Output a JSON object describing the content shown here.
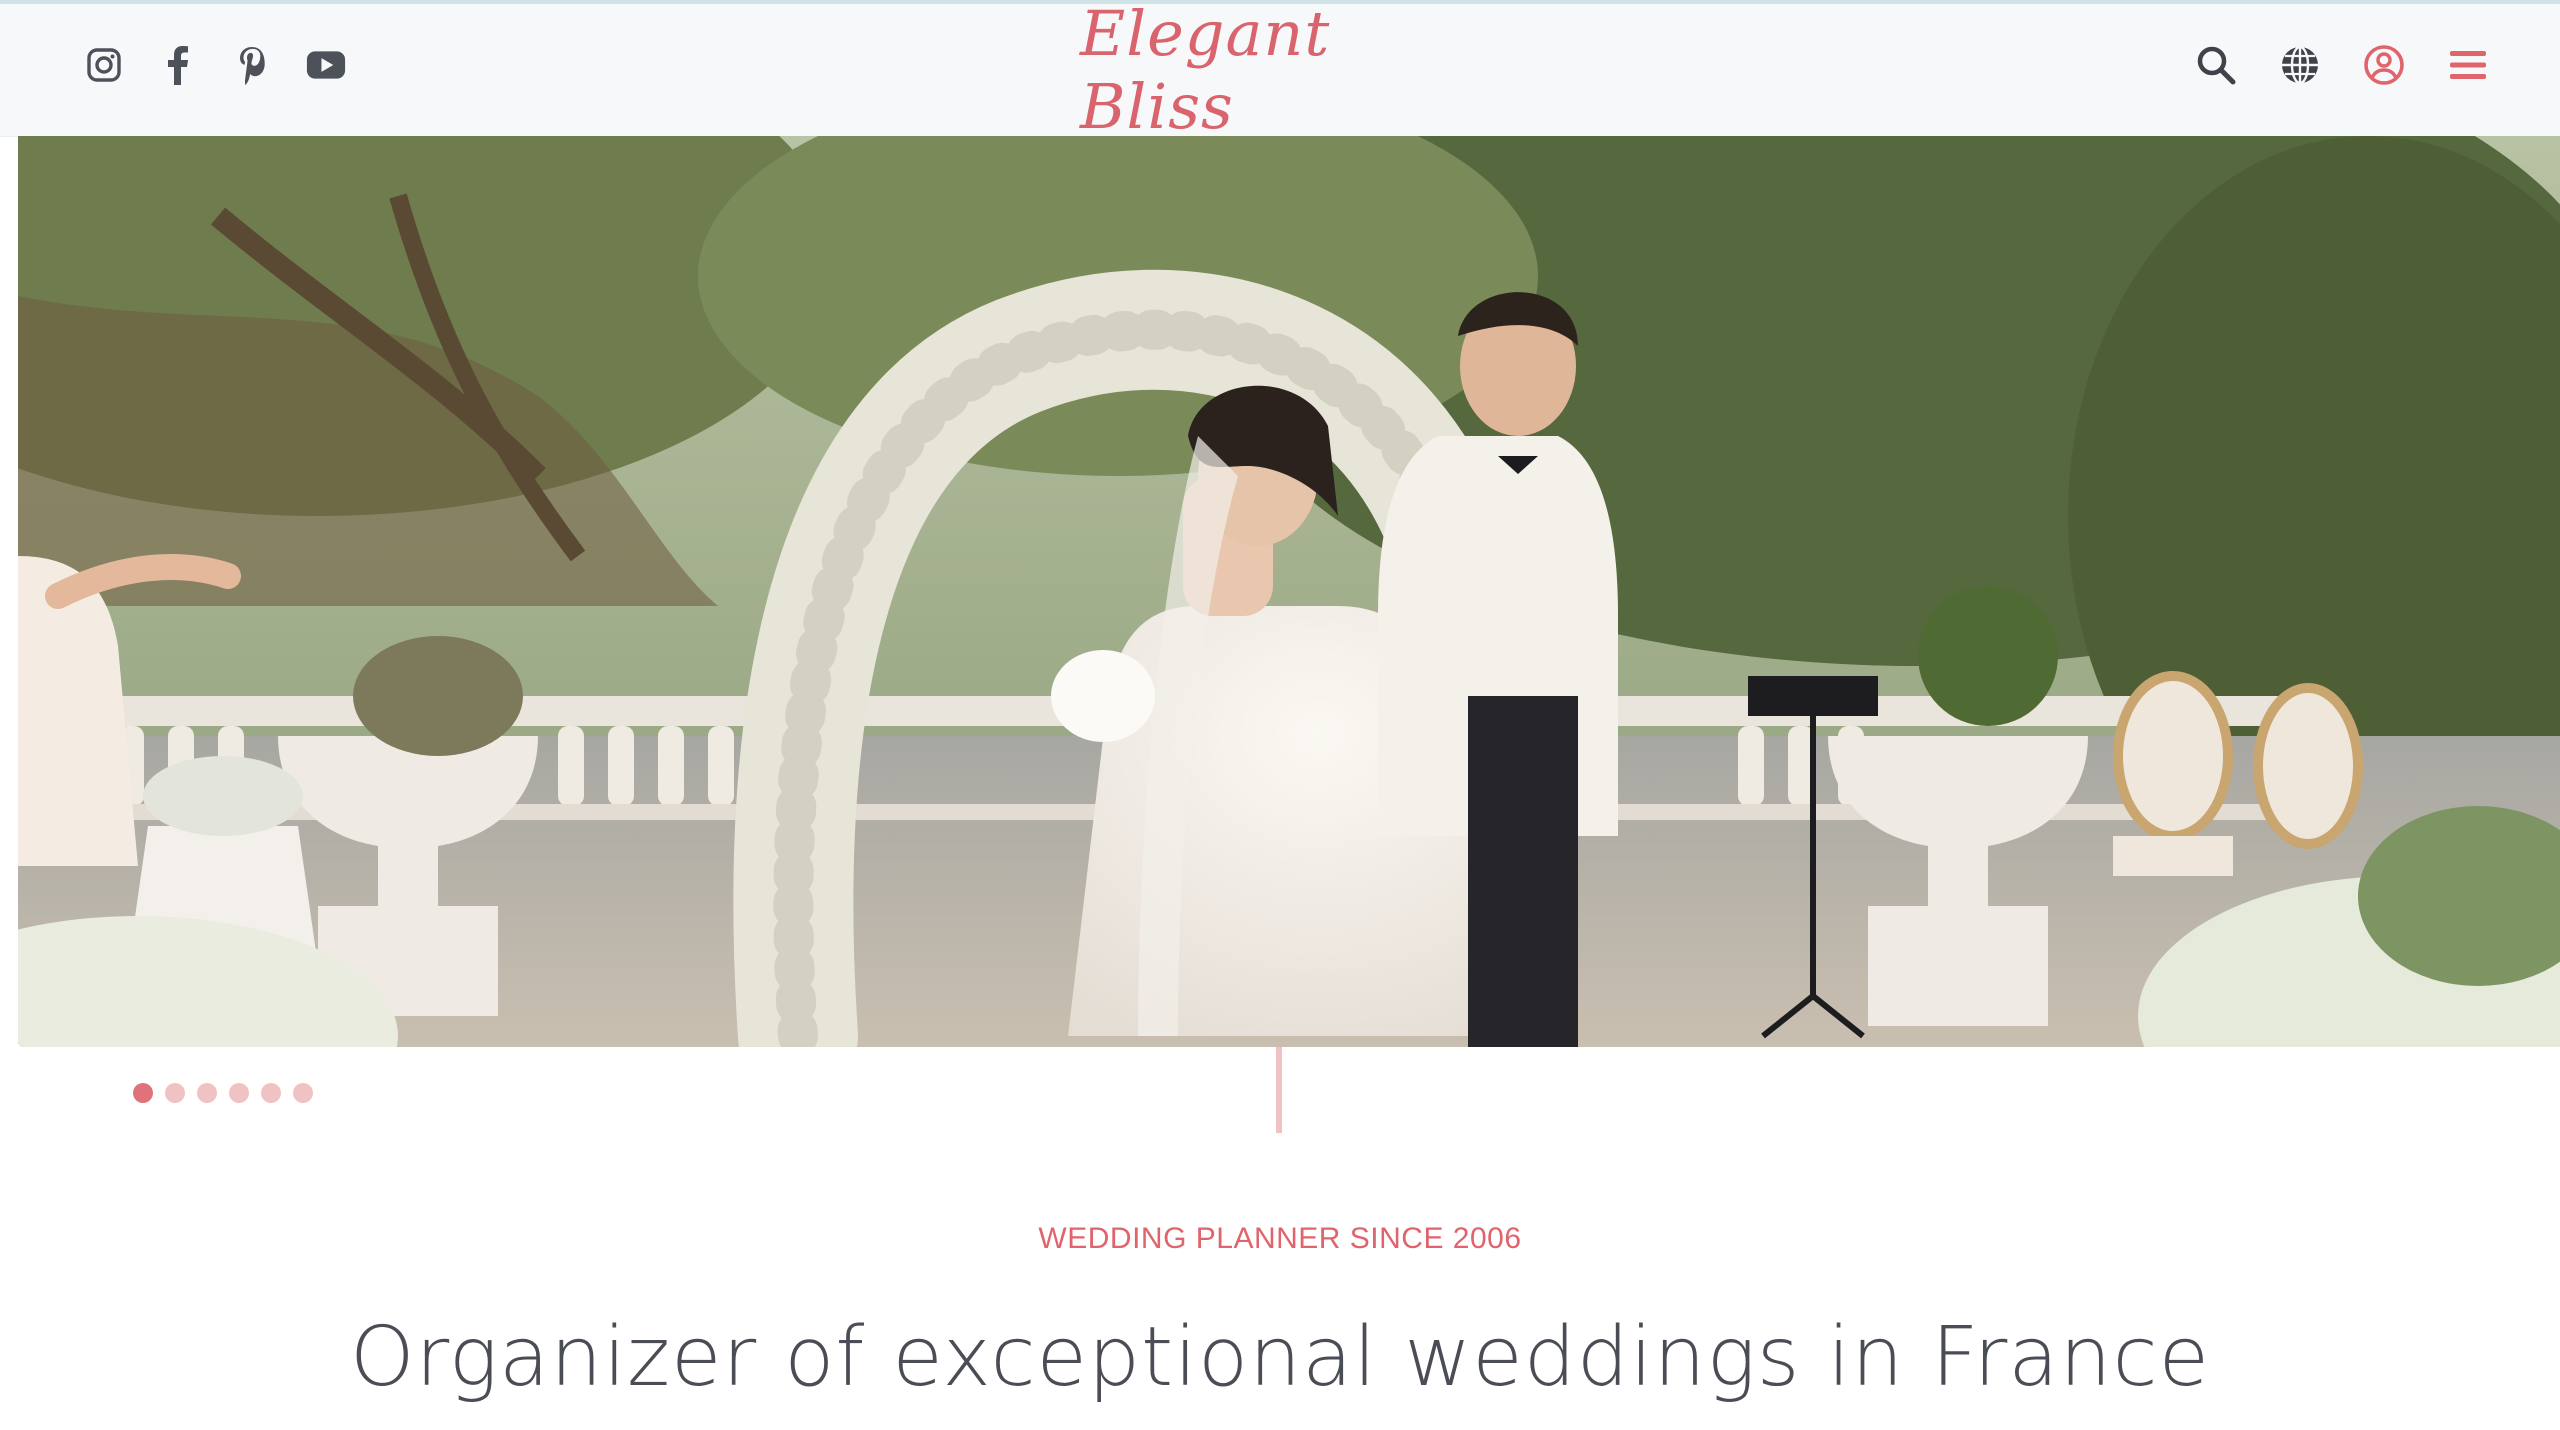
{
  "header": {
    "logo_text": "Elegant Bliss",
    "social_icons": [
      "instagram-icon",
      "facebook-icon",
      "pinterest-icon",
      "youtube-icon"
    ],
    "tool_icons": [
      "search-icon",
      "globe-icon",
      "user-icon",
      "menu-icon"
    ]
  },
  "hero": {
    "image_description_icon": "wedding-couple-photo",
    "slide_count": 6,
    "active_slide": 1
  },
  "intro": {
    "tagline": "WEDDING PLANNER SINCE 2006",
    "headline": "Organizer of exceptional weddings in France"
  },
  "colors": {
    "accent": "#e0646c",
    "logo": "#d9646d",
    "header_bg": "#f7f8fa",
    "text_dark": "#4a4d55",
    "dot_inactive": "#f0c2c4"
  }
}
